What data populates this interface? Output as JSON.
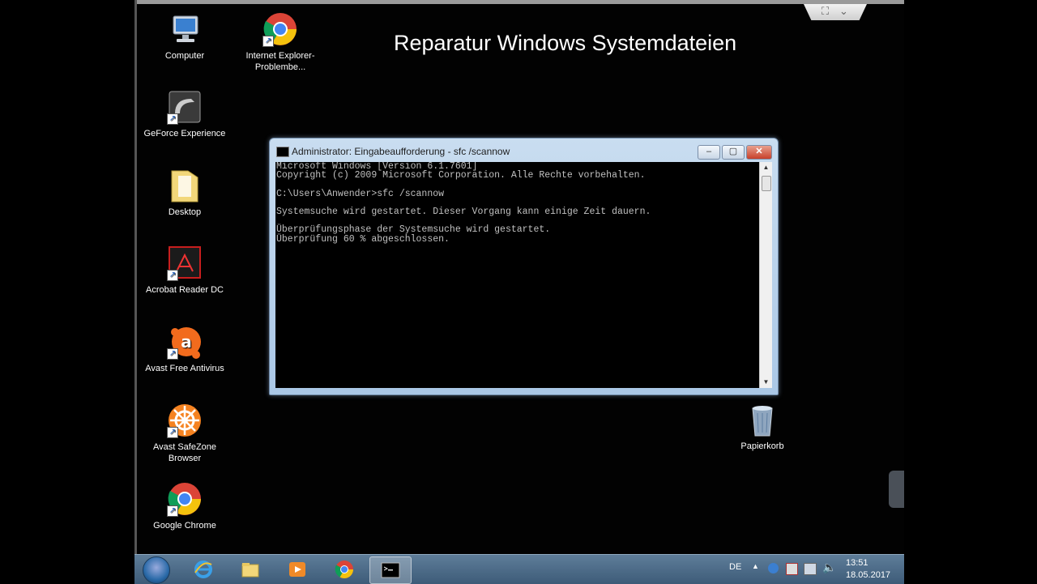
{
  "overlay_title": "Reparatur Windows Systemdateien",
  "desktop_icons": [
    {
      "label": "Computer",
      "icon": "computer-icon"
    },
    {
      "label": "Internet Explorer-Problembe...",
      "icon": "chrome-icon"
    },
    {
      "label": "GeForce Experience",
      "icon": "geforce-icon"
    },
    {
      "label": "Desktop",
      "icon": "folder-icon"
    },
    {
      "label": "Acrobat Reader DC",
      "icon": "acrobat-icon"
    },
    {
      "label": "Avast Free Antivirus",
      "icon": "avast-icon"
    },
    {
      "label": "Avast SafeZone Browser",
      "icon": "safezone-icon"
    },
    {
      "label": "Google Chrome",
      "icon": "chrome-icon"
    },
    {
      "label": "Papierkorb",
      "icon": "recycle-bin-icon"
    }
  ],
  "cmd_window": {
    "title": "Administrator: Eingabeaufforderung - sfc /scannow",
    "minimize": "–",
    "maximize": "▢",
    "close": "✕",
    "lines": [
      "Microsoft Windows [Version 6.1.7601]",
      "Copyright (c) 2009 Microsoft Corporation. Alle Rechte vorbehalten.",
      "",
      "C:\\Users\\Anwender>sfc /scannow",
      "",
      "Systemsuche wird gestartet. Dieser Vorgang kann einige Zeit dauern.",
      "",
      "Überprüfungsphase der Systemsuche wird gestartet.",
      "Überprüfung 60 % abgeschlossen."
    ]
  },
  "taskbar": {
    "language": "DE",
    "time": "13:51",
    "date": "18.05.2017",
    "apps": [
      "ie-icon",
      "explorer-icon",
      "media-player-icon",
      "chrome-icon",
      "cmd-icon"
    ]
  },
  "colors": {
    "desktop": "#020202",
    "taskbar": "#4b6a87",
    "console_text": "#c0c0c0"
  }
}
